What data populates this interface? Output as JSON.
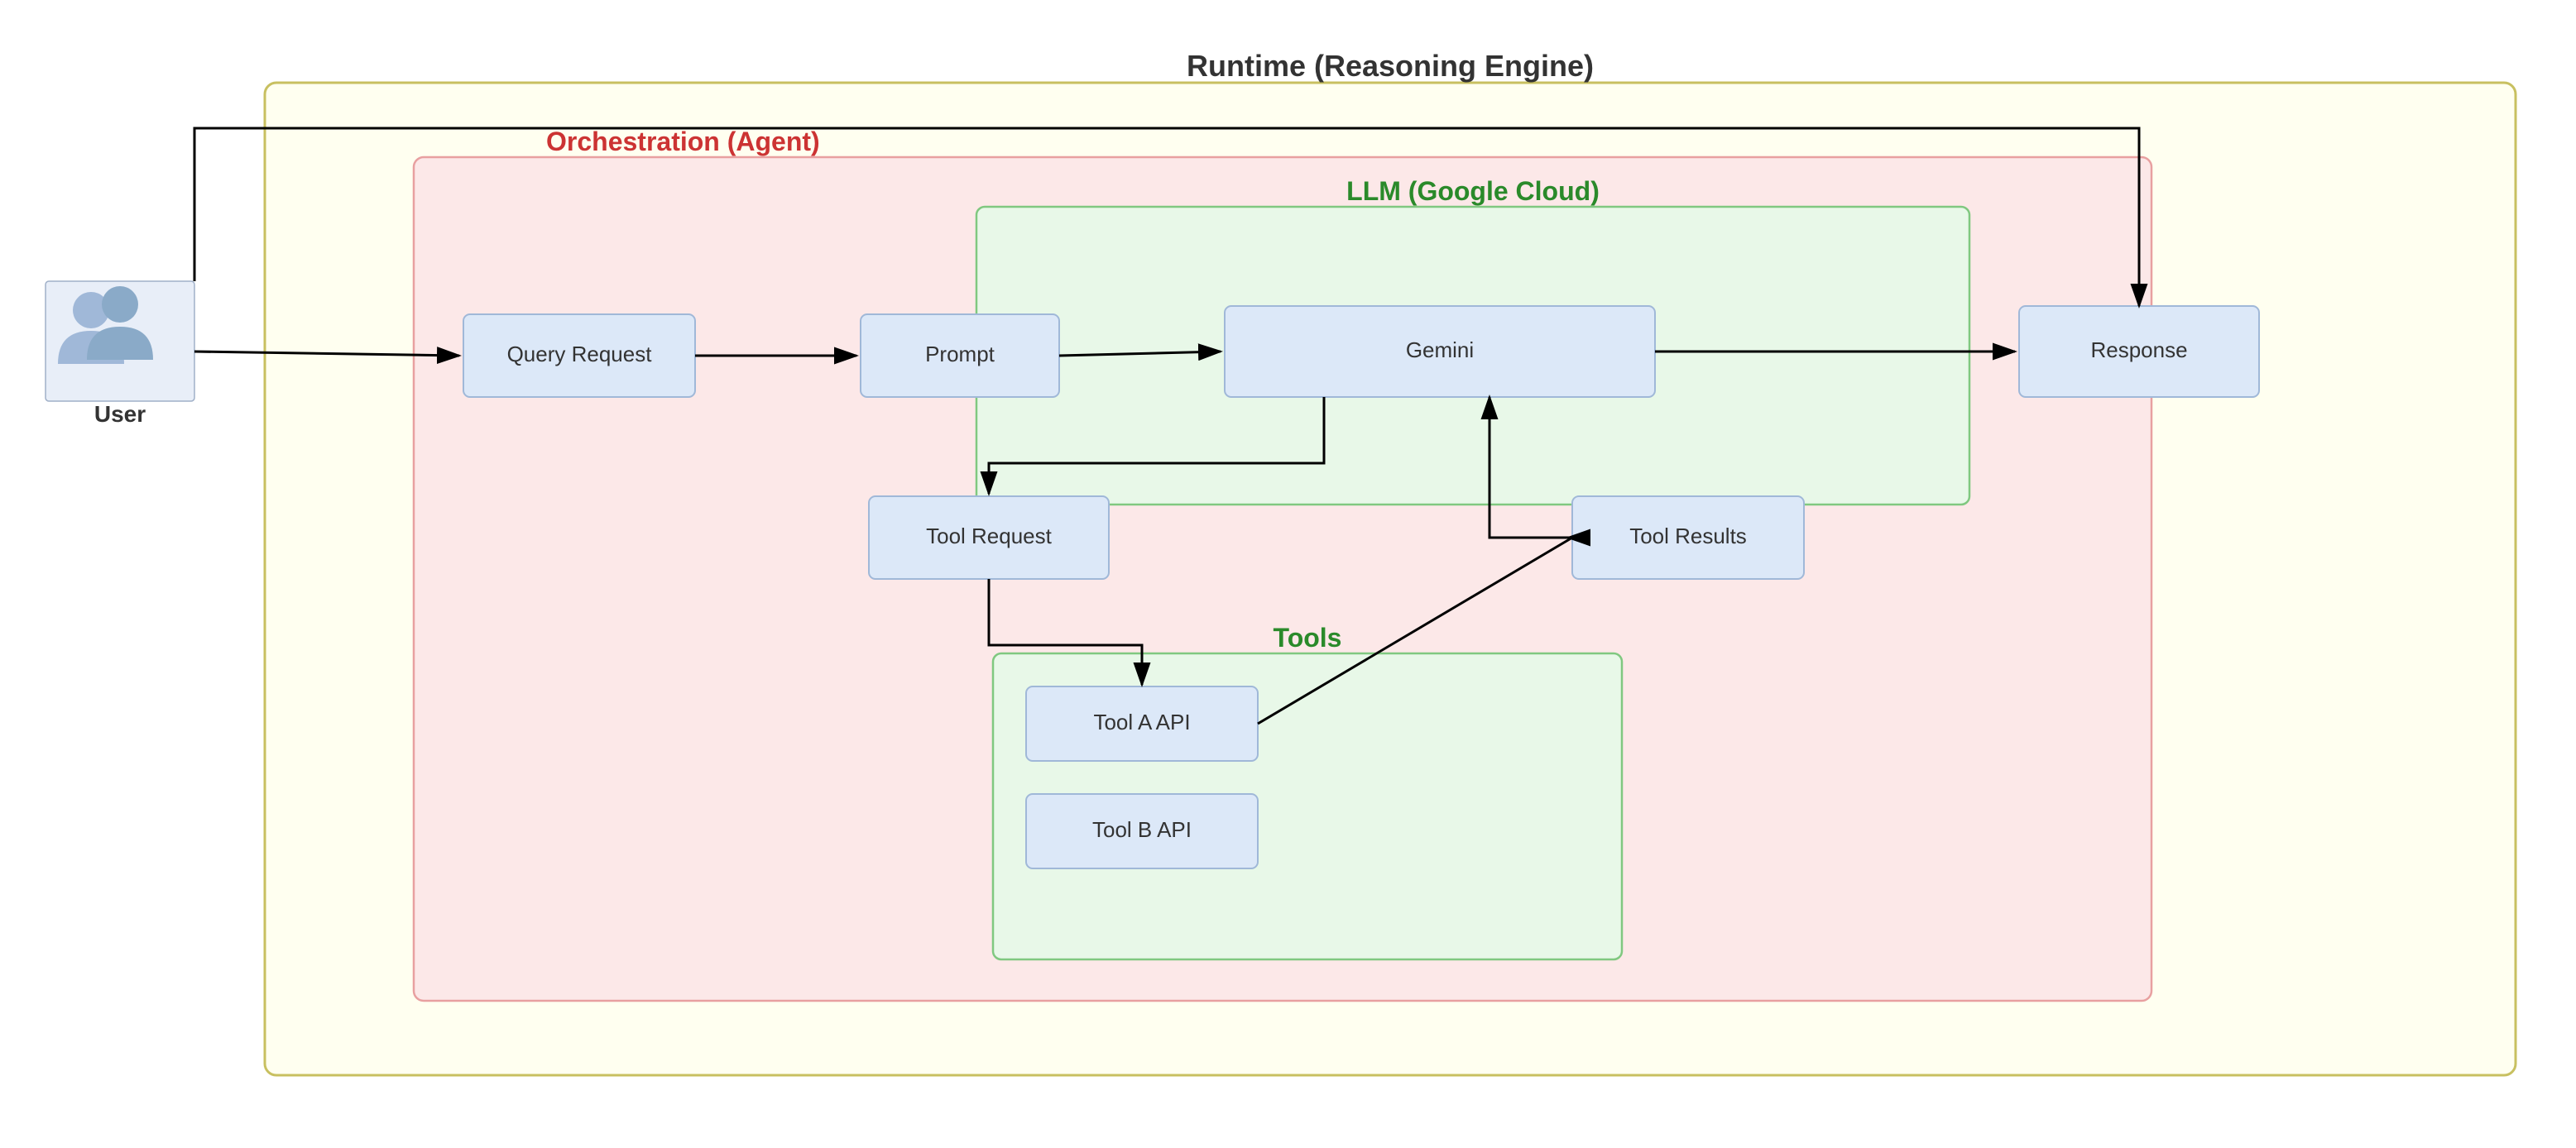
{
  "diagram": {
    "title": "Runtime (Reasoning Engine)",
    "orchestration_label": "Orchestration (Agent)",
    "llm_label": "LLM (Google Cloud)",
    "tools_label": "Tools",
    "user_label": "User",
    "nodes": {
      "query_request": "Query Request",
      "prompt": "Prompt",
      "gemini": "Gemini",
      "response": "Response",
      "tool_request": "Tool Request",
      "tool_results": "Tool Results",
      "tool_a": "Tool A API",
      "tool_b": "Tool B API"
    }
  }
}
